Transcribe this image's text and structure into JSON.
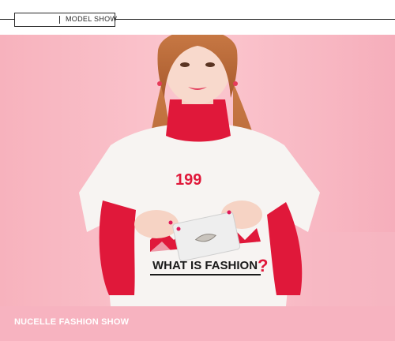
{
  "header": {
    "model_show_label": "MODEL  SHOW"
  },
  "photo": {
    "shirt_number": "199",
    "shirt_slogan": "WHAT IS FASHION",
    "shirt_question": "?"
  },
  "footer": {
    "title": "NUCELLE FASHION SHOW"
  },
  "colors": {
    "background_pink": "#f8b9c3",
    "turtleneck_red": "#e0183a",
    "shirt_white": "#f7f4f2",
    "hair_brown": "#b86a3a",
    "footer_pink": "#f7b3c0"
  }
}
